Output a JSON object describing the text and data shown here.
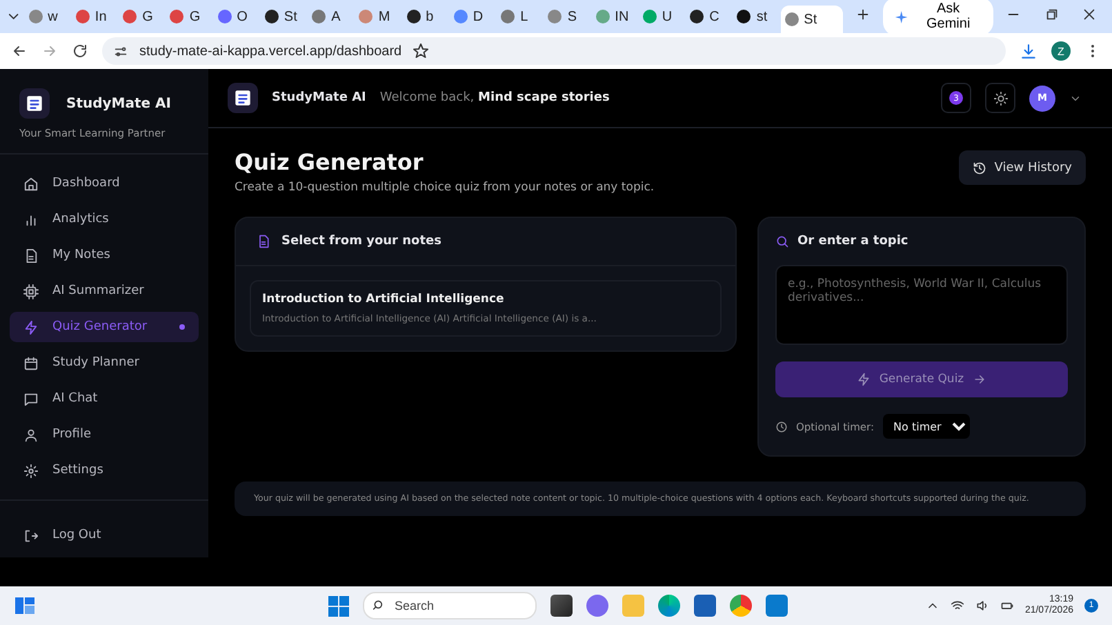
{
  "browser": {
    "tabs": [
      {
        "label": "w",
        "selected": false
      },
      {
        "label": "In",
        "selected": false
      },
      {
        "label": "G",
        "selected": false
      },
      {
        "label": "G",
        "selected": false
      },
      {
        "label": "O",
        "selected": false
      },
      {
        "label": "St",
        "selected": false
      },
      {
        "label": "A",
        "selected": false
      },
      {
        "label": "M",
        "selected": false
      },
      {
        "label": "b",
        "selected": false
      },
      {
        "label": "D",
        "selected": false
      },
      {
        "label": "L",
        "selected": false
      },
      {
        "label": "S",
        "selected": false
      },
      {
        "label": "IN",
        "selected": false
      },
      {
        "label": "U",
        "selected": false
      },
      {
        "label": "C",
        "selected": false
      },
      {
        "label": "st",
        "selected": false
      },
      {
        "label": "St",
        "selected": true
      }
    ],
    "ask_gemini": "Ask Gemini",
    "url": "study-mate-ai-kappa.vercel.app/dashboard",
    "profile": "Z"
  },
  "sidebar": {
    "brand": "StudyMate AI",
    "tagline": "Your Smart Learning Partner",
    "items": [
      {
        "label": "Dashboard",
        "selected": false
      },
      {
        "label": "Analytics",
        "selected": false
      },
      {
        "label": "My Notes",
        "selected": false
      },
      {
        "label": "AI Summarizer",
        "selected": false
      },
      {
        "label": "Quiz Generator",
        "selected": true
      },
      {
        "label": "Study Planner",
        "selected": false
      },
      {
        "label": "AI Chat",
        "selected": false
      },
      {
        "label": "Profile",
        "selected": false
      },
      {
        "label": "Settings",
        "selected": false
      }
    ],
    "logout": "Log Out"
  },
  "header": {
    "brand": "StudyMate AI",
    "welcome": "Welcome back, **Mind scape stories**",
    "notifications": "3",
    "avatar": "M"
  },
  "page": {
    "title": "Quiz Generator",
    "subtitle": "Create a 10-question multiple choice quiz from your notes or any topic.",
    "view_history": "View History"
  },
  "notes_card": {
    "title": "Select from your notes",
    "notes": [
      {
        "title": "Introduction to Artificial Intelligence",
        "excerpt": "Introduction to Artificial Intelligence (AI) Artificial Intelligence (AI) is a..."
      }
    ]
  },
  "topic_card": {
    "title": "Or enter a topic",
    "placeholder": "e.g., Photosynthesis, World War II, Calculus derivatives...",
    "generate": "Generate Quiz",
    "generate_disabled": true,
    "timer_label": "Optional timer:",
    "timer_value": "No timer"
  },
  "info": "Your quiz will be generated using AI based on the selected note content or topic. 10 multiple-choice questions with 4 options each. Keyboard shortcuts supported during the quiz.",
  "taskbar": {
    "search": "Search",
    "time": "13:19",
    "date": "21/07/2026",
    "notifications": "1"
  }
}
